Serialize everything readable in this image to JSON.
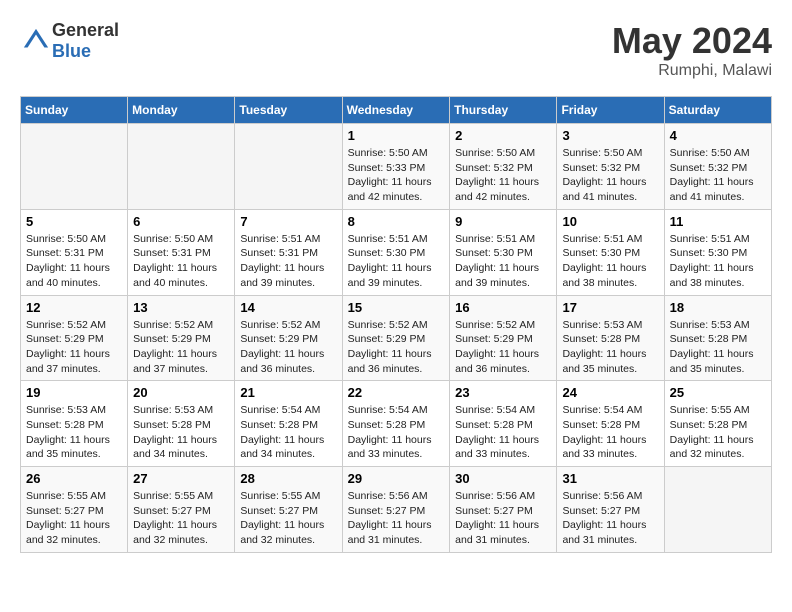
{
  "header": {
    "logo_general": "General",
    "logo_blue": "Blue",
    "title": "May 2024",
    "location": "Rumphi, Malawi"
  },
  "days_of_week": [
    "Sunday",
    "Monday",
    "Tuesday",
    "Wednesday",
    "Thursday",
    "Friday",
    "Saturday"
  ],
  "weeks": [
    [
      {
        "day": "",
        "sunrise": "",
        "sunset": "",
        "daylight": ""
      },
      {
        "day": "",
        "sunrise": "",
        "sunset": "",
        "daylight": ""
      },
      {
        "day": "",
        "sunrise": "",
        "sunset": "",
        "daylight": ""
      },
      {
        "day": "1",
        "sunrise": "Sunrise: 5:50 AM",
        "sunset": "Sunset: 5:33 PM",
        "daylight": "Daylight: 11 hours and 42 minutes."
      },
      {
        "day": "2",
        "sunrise": "Sunrise: 5:50 AM",
        "sunset": "Sunset: 5:32 PM",
        "daylight": "Daylight: 11 hours and 42 minutes."
      },
      {
        "day": "3",
        "sunrise": "Sunrise: 5:50 AM",
        "sunset": "Sunset: 5:32 PM",
        "daylight": "Daylight: 11 hours and 41 minutes."
      },
      {
        "day": "4",
        "sunrise": "Sunrise: 5:50 AM",
        "sunset": "Sunset: 5:32 PM",
        "daylight": "Daylight: 11 hours and 41 minutes."
      }
    ],
    [
      {
        "day": "5",
        "sunrise": "Sunrise: 5:50 AM",
        "sunset": "Sunset: 5:31 PM",
        "daylight": "Daylight: 11 hours and 40 minutes."
      },
      {
        "day": "6",
        "sunrise": "Sunrise: 5:50 AM",
        "sunset": "Sunset: 5:31 PM",
        "daylight": "Daylight: 11 hours and 40 minutes."
      },
      {
        "day": "7",
        "sunrise": "Sunrise: 5:51 AM",
        "sunset": "Sunset: 5:31 PM",
        "daylight": "Daylight: 11 hours and 39 minutes."
      },
      {
        "day": "8",
        "sunrise": "Sunrise: 5:51 AM",
        "sunset": "Sunset: 5:30 PM",
        "daylight": "Daylight: 11 hours and 39 minutes."
      },
      {
        "day": "9",
        "sunrise": "Sunrise: 5:51 AM",
        "sunset": "Sunset: 5:30 PM",
        "daylight": "Daylight: 11 hours and 39 minutes."
      },
      {
        "day": "10",
        "sunrise": "Sunrise: 5:51 AM",
        "sunset": "Sunset: 5:30 PM",
        "daylight": "Daylight: 11 hours and 38 minutes."
      },
      {
        "day": "11",
        "sunrise": "Sunrise: 5:51 AM",
        "sunset": "Sunset: 5:30 PM",
        "daylight": "Daylight: 11 hours and 38 minutes."
      }
    ],
    [
      {
        "day": "12",
        "sunrise": "Sunrise: 5:52 AM",
        "sunset": "Sunset: 5:29 PM",
        "daylight": "Daylight: 11 hours and 37 minutes."
      },
      {
        "day": "13",
        "sunrise": "Sunrise: 5:52 AM",
        "sunset": "Sunset: 5:29 PM",
        "daylight": "Daylight: 11 hours and 37 minutes."
      },
      {
        "day": "14",
        "sunrise": "Sunrise: 5:52 AM",
        "sunset": "Sunset: 5:29 PM",
        "daylight": "Daylight: 11 hours and 36 minutes."
      },
      {
        "day": "15",
        "sunrise": "Sunrise: 5:52 AM",
        "sunset": "Sunset: 5:29 PM",
        "daylight": "Daylight: 11 hours and 36 minutes."
      },
      {
        "day": "16",
        "sunrise": "Sunrise: 5:52 AM",
        "sunset": "Sunset: 5:29 PM",
        "daylight": "Daylight: 11 hours and 36 minutes."
      },
      {
        "day": "17",
        "sunrise": "Sunrise: 5:53 AM",
        "sunset": "Sunset: 5:28 PM",
        "daylight": "Daylight: 11 hours and 35 minutes."
      },
      {
        "day": "18",
        "sunrise": "Sunrise: 5:53 AM",
        "sunset": "Sunset: 5:28 PM",
        "daylight": "Daylight: 11 hours and 35 minutes."
      }
    ],
    [
      {
        "day": "19",
        "sunrise": "Sunrise: 5:53 AM",
        "sunset": "Sunset: 5:28 PM",
        "daylight": "Daylight: 11 hours and 35 minutes."
      },
      {
        "day": "20",
        "sunrise": "Sunrise: 5:53 AM",
        "sunset": "Sunset: 5:28 PM",
        "daylight": "Daylight: 11 hours and 34 minutes."
      },
      {
        "day": "21",
        "sunrise": "Sunrise: 5:54 AM",
        "sunset": "Sunset: 5:28 PM",
        "daylight": "Daylight: 11 hours and 34 minutes."
      },
      {
        "day": "22",
        "sunrise": "Sunrise: 5:54 AM",
        "sunset": "Sunset: 5:28 PM",
        "daylight": "Daylight: 11 hours and 33 minutes."
      },
      {
        "day": "23",
        "sunrise": "Sunrise: 5:54 AM",
        "sunset": "Sunset: 5:28 PM",
        "daylight": "Daylight: 11 hours and 33 minutes."
      },
      {
        "day": "24",
        "sunrise": "Sunrise: 5:54 AM",
        "sunset": "Sunset: 5:28 PM",
        "daylight": "Daylight: 11 hours and 33 minutes."
      },
      {
        "day": "25",
        "sunrise": "Sunrise: 5:55 AM",
        "sunset": "Sunset: 5:28 PM",
        "daylight": "Daylight: 11 hours and 32 minutes."
      }
    ],
    [
      {
        "day": "26",
        "sunrise": "Sunrise: 5:55 AM",
        "sunset": "Sunset: 5:27 PM",
        "daylight": "Daylight: 11 hours and 32 minutes."
      },
      {
        "day": "27",
        "sunrise": "Sunrise: 5:55 AM",
        "sunset": "Sunset: 5:27 PM",
        "daylight": "Daylight: 11 hours and 32 minutes."
      },
      {
        "day": "28",
        "sunrise": "Sunrise: 5:55 AM",
        "sunset": "Sunset: 5:27 PM",
        "daylight": "Daylight: 11 hours and 32 minutes."
      },
      {
        "day": "29",
        "sunrise": "Sunrise: 5:56 AM",
        "sunset": "Sunset: 5:27 PM",
        "daylight": "Daylight: 11 hours and 31 minutes."
      },
      {
        "day": "30",
        "sunrise": "Sunrise: 5:56 AM",
        "sunset": "Sunset: 5:27 PM",
        "daylight": "Daylight: 11 hours and 31 minutes."
      },
      {
        "day": "31",
        "sunrise": "Sunrise: 5:56 AM",
        "sunset": "Sunset: 5:27 PM",
        "daylight": "Daylight: 11 hours and 31 minutes."
      },
      {
        "day": "",
        "sunrise": "",
        "sunset": "",
        "daylight": ""
      }
    ]
  ]
}
